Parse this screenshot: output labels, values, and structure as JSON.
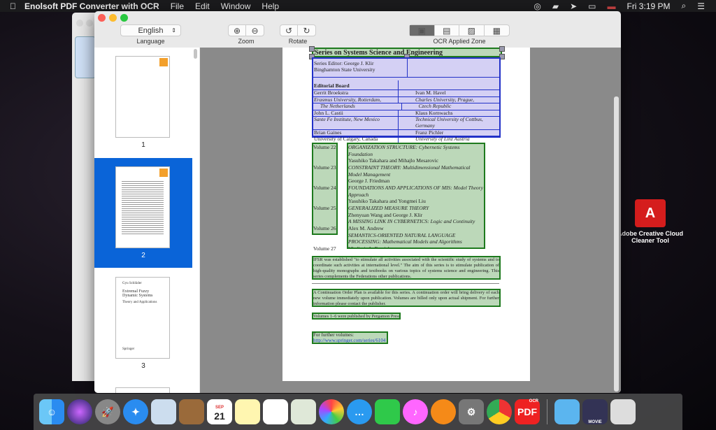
{
  "menubar": {
    "app": "Enolsoft PDF Converter with OCR",
    "items": [
      "File",
      "Edit",
      "Window",
      "Help"
    ],
    "clock": "Fri 3:19 PM"
  },
  "toolbar": {
    "language_value": "English",
    "language_label": "Language",
    "zoom_label": "Zoom",
    "rotate_label": "Rotate",
    "ocr_label": "OCR Applied Zone"
  },
  "sidebar": {
    "pages": [
      "1",
      "2",
      "3"
    ],
    "selected": "2",
    "page3_lines": [
      "Gyu Schlüder",
      "Extremal Fuzzy Dynamic Systems",
      "Theory and Applications",
      "Springer"
    ]
  },
  "document": {
    "title": "Series on Systems Science and Engineering",
    "editor_line1": "Series Editor: George J. Klir",
    "editor_line2": "Binghamton State University",
    "board_heading": "Editorial Board",
    "board": [
      [
        "Gerrit Broekstra",
        "Ivan M. Havel"
      ],
      [
        "Erasmus University, Rotterdam,",
        "Charles University, Prague,"
      ],
      [
        "The Netherlands",
        "Czech Republic"
      ],
      [
        "John L. Castii",
        "Klaus Kornwachs"
      ],
      [
        "Sante Fe Institute, New Mexico",
        "Technical University of Cottbus, Germany"
      ],
      [
        "Brian Gaines",
        "Franz Pichler"
      ],
      [
        "University of Calgary, Canada",
        "University of Linz Austria"
      ]
    ],
    "volumes": [
      {
        "label": "Volume 22",
        "title": "ORGANIZATION STRUCTURE: Cybernetic Systems Foundation",
        "author": "Yasuhiko Takahara and Mihajlo Mesarovic"
      },
      {
        "label": "Volume 23",
        "title": "CONSTRAINT THEORY: Multidimensional Mathematical Model Management",
        "author": "George J. Friedman"
      },
      {
        "label": "Volume 24",
        "title": "FOUNDATIONS AND APPLICATIONS OF MIS: Model Theory Approach",
        "author": "Yasuhiko Takahara and Yongmei Liu"
      },
      {
        "label": "Volume 25",
        "title": "GENERALIZED MEASURE THEORY",
        "author": "Zhenyuan Wang and George J. Klir"
      },
      {
        "label": "Volume 26",
        "title": "A MISSING LINK IN CYBERNETICS: Logic and Continuity",
        "author": "Alex M. Andrew"
      },
      {
        "label": "Volume 27",
        "title": "SEMANTICS-ORIENTED NATURAL LANGUAGE PROCESSING: Mathematical Models and Algorithms",
        "author": "Vladimir A. Fomichov"
      }
    ],
    "ifsr": "IFSR was established \"to stimulate all activities associated with the scientific study of systems and to coordinate such activities at international level.\" The aim of this series is to stimulate publication of high-quality monographs and textbooks on various topics of systems science and engineering. This series complements the Federations other publications.",
    "continuation": "A Continuation Order Plan is available for this series. A continuation order will bring delivery of each new volume immediately upon publication. Volumes are billed only upon actual shipment. For further information please contact the publisher.",
    "pergamon": "Volumes 1–6 were published by Pergamon Press",
    "further": "For further volumes:",
    "link": "http://www.springer.com/series/6104"
  },
  "desktop_icon": "Adobe Creative Cloud Cleaner Tool",
  "dock": {
    "calendar_month": "SEP",
    "calendar_day": "21",
    "pdf_label": "PDF",
    "ocr_badge": "OCR",
    "movie_label": "MOVIE"
  },
  "colors": {
    "ocr_text_zone": "#1e7a1e",
    "ocr_table_zone": "#2231c8",
    "selection": "#0a64d8"
  }
}
